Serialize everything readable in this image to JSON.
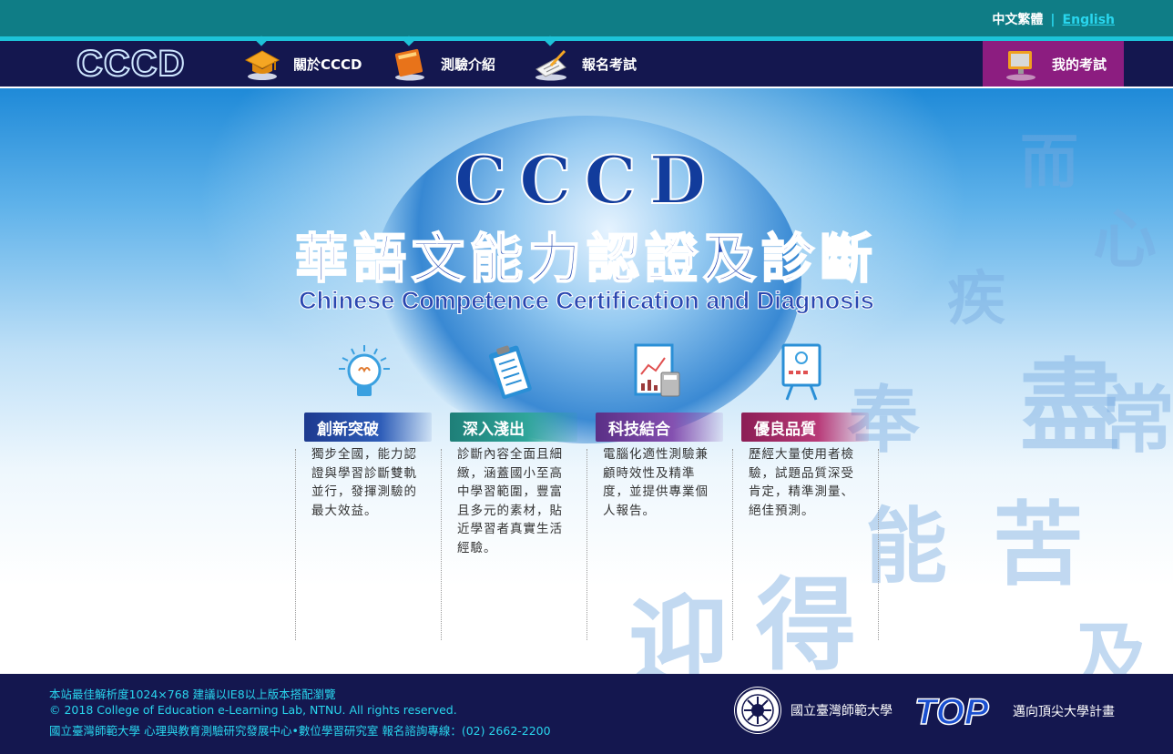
{
  "header": {
    "lang_zh": "中文繁體",
    "lang_sep": "|",
    "lang_en": "English"
  },
  "nav": {
    "logo": "CCCD",
    "items": [
      {
        "label": "關於CCCD",
        "icon": "graduation-cap-icon"
      },
      {
        "label": "測驗介紹",
        "icon": "book-icon"
      },
      {
        "label": "報名考試",
        "icon": "writing-paper-icon"
      }
    ],
    "my_exam": {
      "label": "我的考試",
      "icon": "monitor-icon"
    }
  },
  "hero": {
    "title": "CCCD",
    "title_zh": "華語文能力認證及診斷",
    "title_en": "Chinese Competence Certification and Diagnosis"
  },
  "features": [
    {
      "title": "創新突破",
      "icon": "lightbulb-icon",
      "color": "#1d3a8f",
      "desc": "獨步全國，能力認證與學習診斷雙軌並行，發揮測驗的最大效益。"
    },
    {
      "title": "深入淺出",
      "icon": "clipboard-checklist-icon",
      "color": "#1e7f78",
      "desc": "診斷內容全面且細緻，涵蓋國小至高中學習範圍，豐富且多元的素材，貼近學習者真實生活經驗。"
    },
    {
      "title": "科技結合",
      "icon": "report-calculator-icon",
      "color": "#5a2f86",
      "desc": "電腦化適性測驗兼顧時效性及精準度，並提供專業個人報告。"
    },
    {
      "title": "優良品質",
      "icon": "presentation-board-icon",
      "color": "#8c1d55",
      "desc": "歷經大量使用者檢驗，試題品質深受肯定，精準測量、絕佳預測。"
    }
  ],
  "footer": {
    "line1": "本站最佳解析度1024×768 建議以IE8以上版本搭配瀏覽",
    "line2": "© 2018 College of Education e-Learning Lab, NTNU. All rights reserved.",
    "line3": "國立臺灣師範大學 心理與教育測驗研究發展中心•數位學習研究室 報名諮詢專線：(02) 2662-2200",
    "university": "國立臺灣師範大學",
    "top_logo": "TOP",
    "top_text": "邁向頂尖大學計畫"
  }
}
